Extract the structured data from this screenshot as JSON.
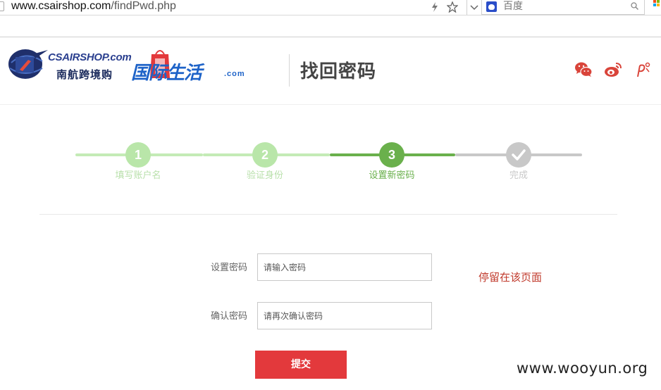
{
  "browser": {
    "url_host": "www.csairshop.com",
    "url_path": "/findPwd.php",
    "search_engine_label": "百度"
  },
  "header": {
    "logo_csair_top": "CSAIRSHOP.com",
    "logo_csair_bottom": "南航跨境购",
    "logo_gjsh": "国际生活",
    "logo_gjsh_suffix": ".com",
    "title": "找回密码",
    "social_icons": [
      "wechat-icon",
      "weibo-icon",
      "other-social-icon"
    ]
  },
  "steps": [
    {
      "number": "1",
      "label": "填写账户名",
      "state": "done"
    },
    {
      "number": "2",
      "label": "验证身份",
      "state": "done"
    },
    {
      "number": "3",
      "label": "设置新密码",
      "state": "current"
    },
    {
      "number": "",
      "label": "完成",
      "state": "pending"
    }
  ],
  "form": {
    "password_label": "设置密码",
    "password_placeholder": "请输入密码",
    "confirm_label": "确认密码",
    "confirm_placeholder": "请再次确认密码",
    "submit_label": "提交"
  },
  "annotation": "停留在该页面",
  "watermark": "www.wooyun.org",
  "colors": {
    "step_done": "#b9e6a9",
    "step_current": "#6ab04c",
    "step_pending": "#c8c8c8",
    "submit": "#e3393c",
    "annotation": "#c0392b",
    "social": "#d9443a"
  }
}
